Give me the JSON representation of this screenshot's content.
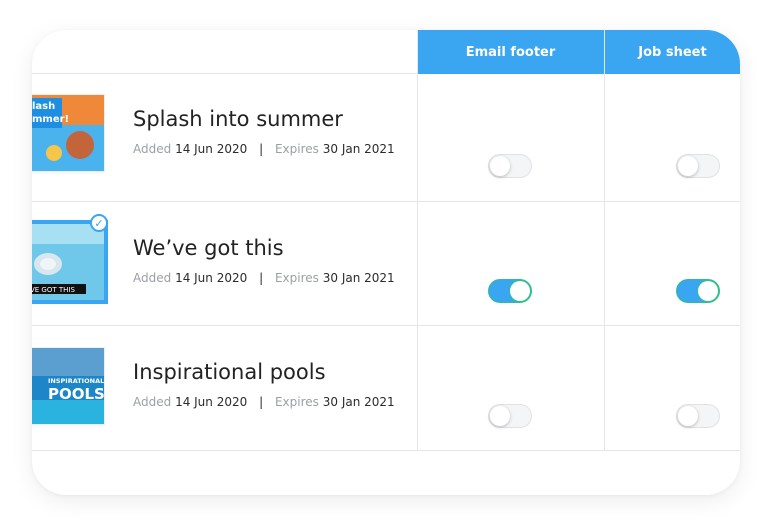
{
  "columns": [
    "Email footer",
    "Job sheet"
  ],
  "rows": [
    {
      "title": "Splash into summer",
      "added_label": "Added",
      "added_date": "14 Jun 2020",
      "separator": "|",
      "expires_label": "Expires",
      "expires_date": "30 Jan 2021",
      "thumb_text": "lash\nmmer!",
      "selected": false,
      "toggles": [
        false,
        false
      ]
    },
    {
      "title": "We’ve got this",
      "added_label": "Added",
      "added_date": "14 Jun 2020",
      "separator": "|",
      "expires_label": "Expires",
      "expires_date": "30 Jan 2021",
      "thumb_text": "VE GOT THIS",
      "selected": true,
      "toggles": [
        true,
        true
      ]
    },
    {
      "title": "Inspirational pools",
      "added_label": "Added",
      "added_date": "14 Jun 2020",
      "separator": "|",
      "expires_label": "Expires",
      "expires_date": "30 Jan 2021",
      "thumb_text_small": "INSPIRATIONAL",
      "thumb_text_big": "POOLS",
      "selected": false,
      "toggles": [
        false,
        false
      ]
    }
  ],
  "colors": {
    "accent": "#3aa5f0",
    "toggle_on_border": "#2fc08a",
    "divider": "#e3e6ea"
  },
  "icons": {
    "selected": "check-icon"
  }
}
